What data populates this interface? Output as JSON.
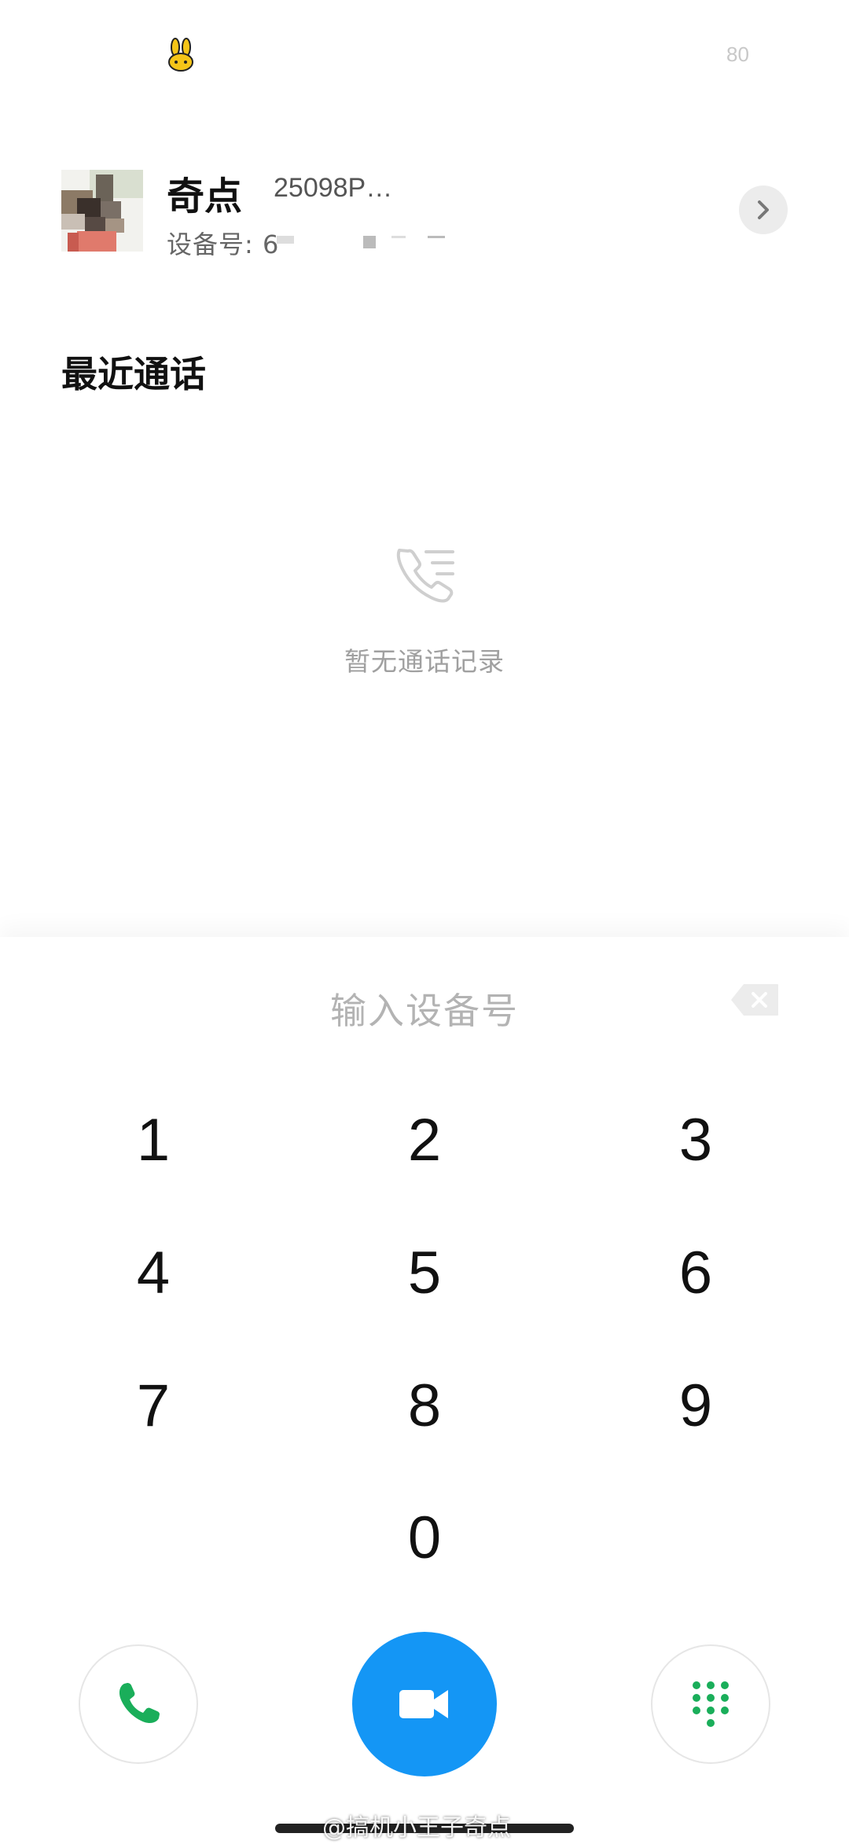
{
  "status_bar": {
    "mascot_icon": "bunny-mascot-icon",
    "battery": "80"
  },
  "profile": {
    "name": "奇点",
    "model": "25098P…",
    "device_label": "设备号: 6"
  },
  "recent": {
    "title": "最近通话",
    "empty_text": "暂无通话记录",
    "empty_icon": "call-log-icon"
  },
  "dialer": {
    "placeholder": "输入设备号",
    "keys": [
      "1",
      "2",
      "3",
      "4",
      "5",
      "6",
      "7",
      "8",
      "9",
      "0"
    ]
  },
  "actions": {
    "voice_icon": "phone-icon",
    "video_icon": "video-camera-icon",
    "keypad_icon": "dialpad-icon"
  },
  "watermark": "@搞机小王子奇点",
  "colors": {
    "accent_blue": "#1496f5",
    "call_green": "#1aae5a"
  }
}
